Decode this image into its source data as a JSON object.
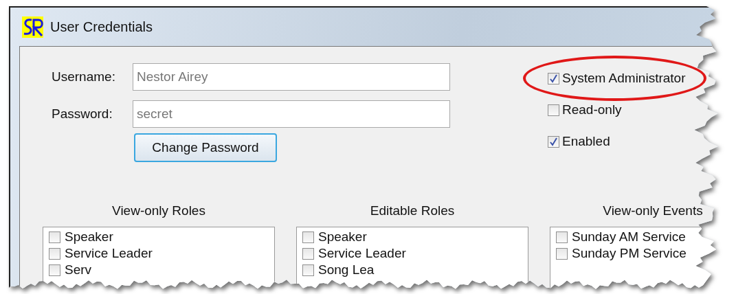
{
  "window": {
    "title": "User Credentials"
  },
  "fields": [
    {
      "label": "Username:",
      "value": "Nestor Airey"
    },
    {
      "label": "Password:",
      "value": "secret"
    }
  ],
  "change_password_button": "Change Password",
  "flags": [
    {
      "label": "System Administrator",
      "checked": true,
      "highlighted": true
    },
    {
      "label": "Read-only",
      "checked": false,
      "highlighted": false
    },
    {
      "label": "Enabled",
      "checked": true,
      "highlighted": false
    }
  ],
  "lists": [
    {
      "title": "View-only Roles",
      "items": [
        {
          "label": "Speaker",
          "checked": false
        },
        {
          "label": "Service Leader",
          "checked": false
        },
        {
          "label": "Serv",
          "checked": false
        }
      ]
    },
    {
      "title": "Editable Roles",
      "items": [
        {
          "label": "Speaker",
          "checked": false
        },
        {
          "label": "Service Leader",
          "checked": false
        },
        {
          "label": "Song Lea",
          "checked": false
        }
      ]
    },
    {
      "title": "View-only Events",
      "items": [
        {
          "label": "Sunday AM Service",
          "checked": false
        },
        {
          "label": "Sunday PM Service",
          "checked": false
        }
      ]
    }
  ]
}
